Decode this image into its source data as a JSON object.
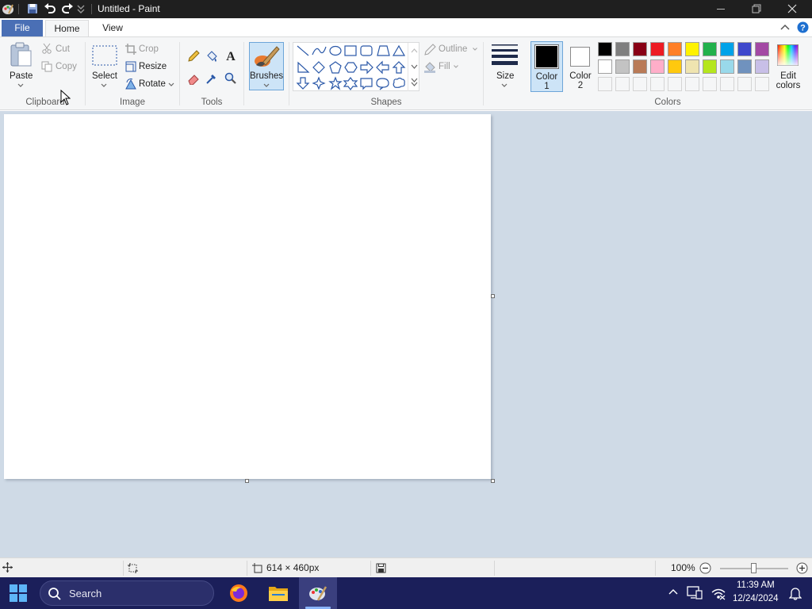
{
  "window": {
    "title": "Untitled - Paint"
  },
  "tabs": [
    {
      "label": "File"
    },
    {
      "label": "Home"
    },
    {
      "label": "View"
    }
  ],
  "ribbon": {
    "clipboard": {
      "paste": "Paste",
      "cut": "Cut",
      "copy": "Copy",
      "group": "Clipboard"
    },
    "image": {
      "select": "Select",
      "crop": "Crop",
      "resize": "Resize",
      "rotate": "Rotate",
      "group": "Image"
    },
    "tools": {
      "group": "Tools"
    },
    "brushes": {
      "label": "Brushes"
    },
    "shapes": {
      "outline": "Outline",
      "fill": "Fill",
      "group": "Shapes"
    },
    "size": {
      "label": "Size"
    },
    "color1": {
      "line1": "Color",
      "line2": "1",
      "value": "#000000"
    },
    "color2": {
      "line1": "Color",
      "line2": "2",
      "value": "#ffffff"
    },
    "colors": {
      "group": "Colors",
      "row1": [
        "#000000",
        "#7f7f7f",
        "#880015",
        "#ed1c24",
        "#ff7f27",
        "#fff200",
        "#22b14c",
        "#00a2e8",
        "#3f48cc",
        "#a349a4"
      ],
      "row2": [
        "#ffffff",
        "#c3c3c3",
        "#b97a57",
        "#ffaec9",
        "#ffc90e",
        "#efe4b0",
        "#b5e61d",
        "#99d9ea",
        "#7092be",
        "#c8bfe7"
      ]
    },
    "edit_colors": {
      "line1": "Edit",
      "line2": "colors"
    }
  },
  "statusbar": {
    "dimensions": "614 × 460px",
    "zoom": "100%"
  },
  "taskbar": {
    "search": "Search",
    "time": "11:39 AM",
    "date": "12/24/2024"
  }
}
